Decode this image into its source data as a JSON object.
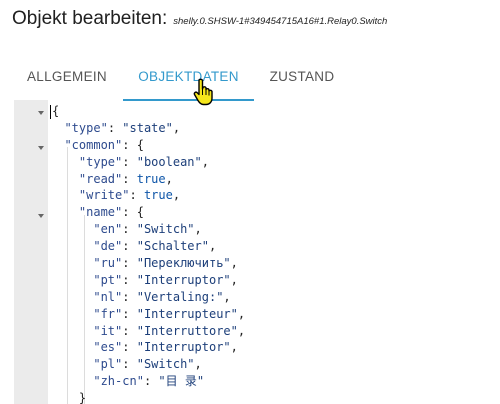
{
  "dialog": {
    "title": "Objekt bearbeiten:",
    "object_id": "shelly.0.SHSW-1#349454715A16#1.Relay0.Switch"
  },
  "tabs": [
    {
      "label": "ALLGEMEIN",
      "active": false
    },
    {
      "label": "OBJEKTDATEN",
      "active": true
    },
    {
      "label": "ZUSTAND",
      "active": false
    }
  ],
  "colors": {
    "accent": "#3399cc",
    "gutter": "#ebebeb"
  },
  "editor": {
    "lines": [
      {
        "indent": 0,
        "parts": [
          {
            "t": "{",
            "c": "punct"
          }
        ]
      },
      {
        "indent": 1,
        "parts": [
          {
            "t": "\"type\"",
            "c": "key"
          },
          {
            "t": ": ",
            "c": "punct"
          },
          {
            "t": "\"state\"",
            "c": "str"
          },
          {
            "t": ",",
            "c": "punct"
          }
        ]
      },
      {
        "indent": 1,
        "parts": [
          {
            "t": "\"common\"",
            "c": "key"
          },
          {
            "t": ": {",
            "c": "punct"
          }
        ]
      },
      {
        "indent": 2,
        "parts": [
          {
            "t": "\"type\"",
            "c": "key"
          },
          {
            "t": ": ",
            "c": "punct"
          },
          {
            "t": "\"boolean\"",
            "c": "str"
          },
          {
            "t": ",",
            "c": "punct"
          }
        ]
      },
      {
        "indent": 2,
        "parts": [
          {
            "t": "\"read\"",
            "c": "key"
          },
          {
            "t": ": ",
            "c": "punct"
          },
          {
            "t": "true",
            "c": "kw"
          },
          {
            "t": ",",
            "c": "punct"
          }
        ]
      },
      {
        "indent": 2,
        "parts": [
          {
            "t": "\"write\"",
            "c": "key"
          },
          {
            "t": ": ",
            "c": "punct"
          },
          {
            "t": "true",
            "c": "kw"
          },
          {
            "t": ",",
            "c": "punct"
          }
        ]
      },
      {
        "indent": 2,
        "parts": [
          {
            "t": "\"name\"",
            "c": "key"
          },
          {
            "t": ": {",
            "c": "punct"
          }
        ]
      },
      {
        "indent": 3,
        "parts": [
          {
            "t": "\"en\"",
            "c": "key"
          },
          {
            "t": ": ",
            "c": "punct"
          },
          {
            "t": "\"Switch\"",
            "c": "str"
          },
          {
            "t": ",",
            "c": "punct"
          }
        ]
      },
      {
        "indent": 3,
        "parts": [
          {
            "t": "\"de\"",
            "c": "key"
          },
          {
            "t": ": ",
            "c": "punct"
          },
          {
            "t": "\"Schalter\"",
            "c": "str"
          },
          {
            "t": ",",
            "c": "punct"
          }
        ]
      },
      {
        "indent": 3,
        "parts": [
          {
            "t": "\"ru\"",
            "c": "key"
          },
          {
            "t": ": ",
            "c": "punct"
          },
          {
            "t": "\"Переключить\"",
            "c": "str"
          },
          {
            "t": ",",
            "c": "punct"
          }
        ]
      },
      {
        "indent": 3,
        "parts": [
          {
            "t": "\"pt\"",
            "c": "key"
          },
          {
            "t": ": ",
            "c": "punct"
          },
          {
            "t": "\"Interruptor\"",
            "c": "str"
          },
          {
            "t": ",",
            "c": "punct"
          }
        ]
      },
      {
        "indent": 3,
        "parts": [
          {
            "t": "\"nl\"",
            "c": "key"
          },
          {
            "t": ": ",
            "c": "punct"
          },
          {
            "t": "\"Vertaling:\"",
            "c": "str"
          },
          {
            "t": ",",
            "c": "punct"
          }
        ]
      },
      {
        "indent": 3,
        "parts": [
          {
            "t": "\"fr\"",
            "c": "key"
          },
          {
            "t": ": ",
            "c": "punct"
          },
          {
            "t": "\"Interrupteur\"",
            "c": "str"
          },
          {
            "t": ",",
            "c": "punct"
          }
        ]
      },
      {
        "indent": 3,
        "parts": [
          {
            "t": "\"it\"",
            "c": "key"
          },
          {
            "t": ": ",
            "c": "punct"
          },
          {
            "t": "\"Interruttore\"",
            "c": "str"
          },
          {
            "t": ",",
            "c": "punct"
          }
        ]
      },
      {
        "indent": 3,
        "parts": [
          {
            "t": "\"es\"",
            "c": "key"
          },
          {
            "t": ": ",
            "c": "punct"
          },
          {
            "t": "\"Interruptor\"",
            "c": "str"
          },
          {
            "t": ",",
            "c": "punct"
          }
        ]
      },
      {
        "indent": 3,
        "parts": [
          {
            "t": "\"pl\"",
            "c": "key"
          },
          {
            "t": ": ",
            "c": "punct"
          },
          {
            "t": "\"Switch\"",
            "c": "str"
          },
          {
            "t": ",",
            "c": "punct"
          }
        ]
      },
      {
        "indent": 3,
        "parts": [
          {
            "t": "\"zh-cn\"",
            "c": "key"
          },
          {
            "t": ": ",
            "c": "punct"
          },
          {
            "t": "\"目 录\"",
            "c": "str"
          }
        ]
      },
      {
        "indent": 2,
        "parts": [
          {
            "t": "}",
            "c": "punct"
          }
        ]
      }
    ]
  }
}
